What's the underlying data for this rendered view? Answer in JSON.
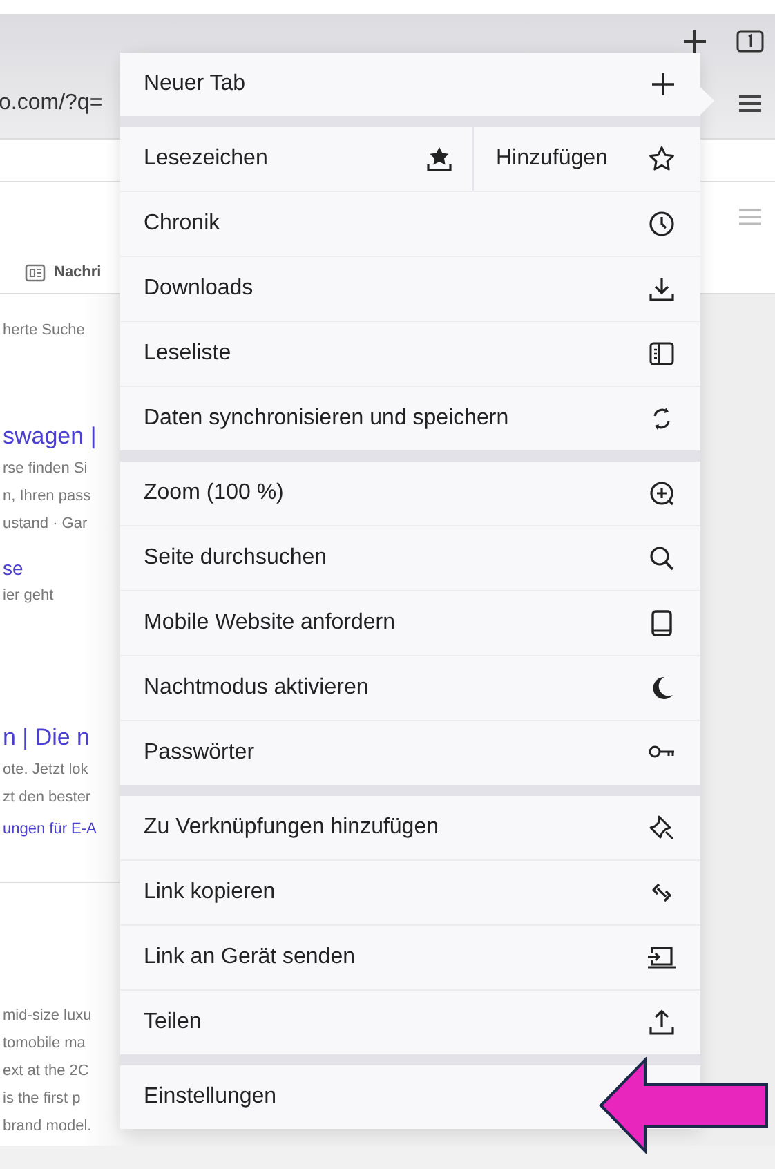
{
  "toolbar": {
    "url": "o.com/?q="
  },
  "page": {
    "tab_label": "Nachri",
    "groups": [
      [
        {
          "kind": "note",
          "text": "herte Suche"
        }
      ],
      [
        {
          "kind": "title",
          "text": "swagen |"
        },
        {
          "kind": "text",
          "text": "rse finden Si"
        },
        {
          "kind": "text",
          "text": "n, Ihren pass"
        },
        {
          "kind": "text",
          "text": "ustand · Gar"
        },
        {
          "kind": "link",
          "text": "se"
        },
        {
          "kind": "text",
          "text": "ier geht"
        }
      ],
      [
        {
          "kind": "title",
          "text": "n | Die n"
        },
        {
          "kind": "text",
          "text": "ote. Jetzt lok"
        },
        {
          "kind": "text",
          "text": "zt den bester"
        },
        {
          "kind": "small-link",
          "text": "ungen für E-A"
        }
      ],
      [
        {
          "kind": "text",
          "text": "mid-size luxu"
        },
        {
          "kind": "text",
          "text": "tomobile ma"
        },
        {
          "kind": "text",
          "text": "ext at the 2C"
        },
        {
          "kind": "text",
          "text": "is the first p"
        },
        {
          "kind": "text",
          "text": "brand model."
        }
      ]
    ]
  },
  "menu": {
    "sections": [
      [
        {
          "label": "Neuer Tab"
        }
      ],
      [
        {
          "label": "Lesezeichen",
          "secondary": "Hinzufügen"
        },
        {
          "label": "Chronik"
        },
        {
          "label": "Downloads"
        },
        {
          "label": "Leseliste"
        },
        {
          "label": "Daten synchronisieren und speichern"
        }
      ],
      [
        {
          "label": "Zoom (100 %)"
        },
        {
          "label": "Seite durchsuchen"
        },
        {
          "label": "Mobile Website anfordern"
        },
        {
          "label": "Nachtmodus aktivieren"
        },
        {
          "label": "Passwörter"
        }
      ],
      [
        {
          "label": "Zu Verknüpfungen hinzufügen"
        },
        {
          "label": "Link kopieren"
        },
        {
          "label": "Link an Gerät senden"
        },
        {
          "label": "Teilen"
        }
      ],
      [
        {
          "label": "Einstellungen"
        }
      ]
    ]
  }
}
